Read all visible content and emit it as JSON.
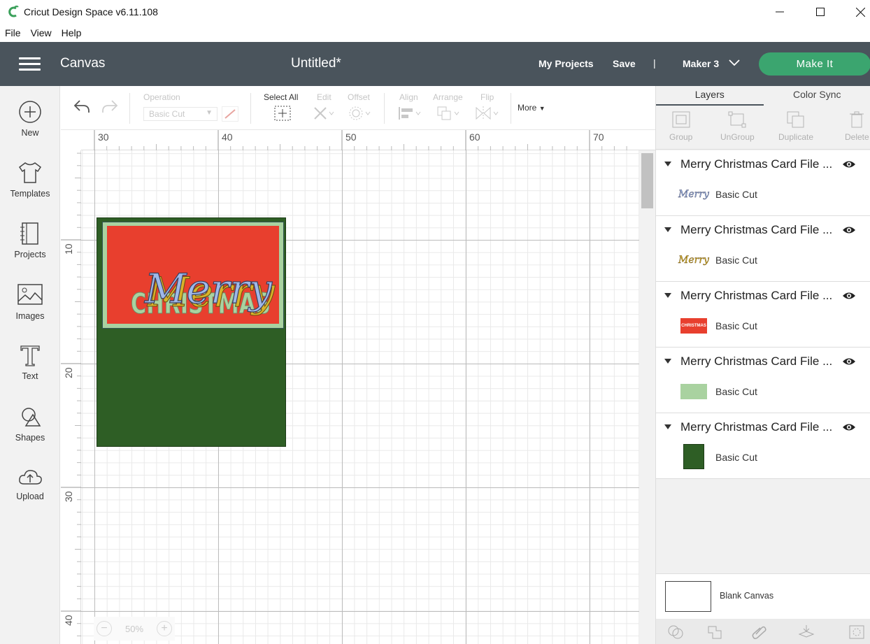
{
  "window": {
    "title": "Cricut Design Space  v6.11.108",
    "menu": [
      "File",
      "View",
      "Help"
    ]
  },
  "header": {
    "canvas_label": "Canvas",
    "doc_title": "Untitled*",
    "my_projects": "My Projects",
    "save": "Save",
    "separator": "|",
    "machine": "Maker 3",
    "make_it": "Make It"
  },
  "sidebar": {
    "items": [
      {
        "label": "New",
        "icon": "plus-circle-icon"
      },
      {
        "label": "Templates",
        "icon": "tshirt-icon"
      },
      {
        "label": "Projects",
        "icon": "notebook-icon"
      },
      {
        "label": "Images",
        "icon": "image-icon"
      },
      {
        "label": "Text",
        "icon": "text-t-icon"
      },
      {
        "label": "Shapes",
        "icon": "shapes-icon"
      },
      {
        "label": "Upload",
        "icon": "cloud-upload-icon"
      }
    ]
  },
  "toolbar": {
    "operation_label": "Operation",
    "operation_value": "Basic Cut",
    "select_all": "Select All",
    "edit": "Edit",
    "offset": "Offset",
    "align": "Align",
    "arrange": "Arrange",
    "flip": "Flip",
    "more": "More"
  },
  "rulers": {
    "horizontal": [
      "30",
      "40",
      "50",
      "60",
      "70"
    ],
    "vertical": [
      "10",
      "20",
      "30",
      "40"
    ]
  },
  "zoom": {
    "minus": "−",
    "value": "50%",
    "plus": "+"
  },
  "design": {
    "colors": {
      "outer": "#2e5e25",
      "light": "#a9d2a0",
      "red": "#e83f2e",
      "merry": "#9fb8e8",
      "merry_gold": "#d7b32a"
    }
  },
  "right_panel": {
    "tabs": [
      "Layers",
      "Color Sync"
    ],
    "tools": [
      "Group",
      "UnGroup",
      "Duplicate",
      "Delete"
    ],
    "layers": [
      {
        "name": "Merry Christmas Card File ...",
        "op": "Basic Cut",
        "thumb_text": "Merry",
        "thumb_color": "#9fb8e8"
      },
      {
        "name": "Merry Christmas Card File ...",
        "op": "Basic Cut",
        "thumb_text": "Merry",
        "thumb_color": "#d7b32a"
      },
      {
        "name": "Merry Christmas Card File ...",
        "op": "Basic Cut",
        "thumb_text": "CHRISTMAS",
        "thumb_color": "#e83f2e"
      },
      {
        "name": "Merry Christmas Card File ...",
        "op": "Basic Cut",
        "thumb_text": "",
        "thumb_color": "#a9d2a0"
      },
      {
        "name": "Merry Christmas Card File ...",
        "op": "Basic Cut",
        "thumb_text": "",
        "thumb_color": "#2e5e25"
      }
    ],
    "blank_canvas": "Blank Canvas"
  }
}
